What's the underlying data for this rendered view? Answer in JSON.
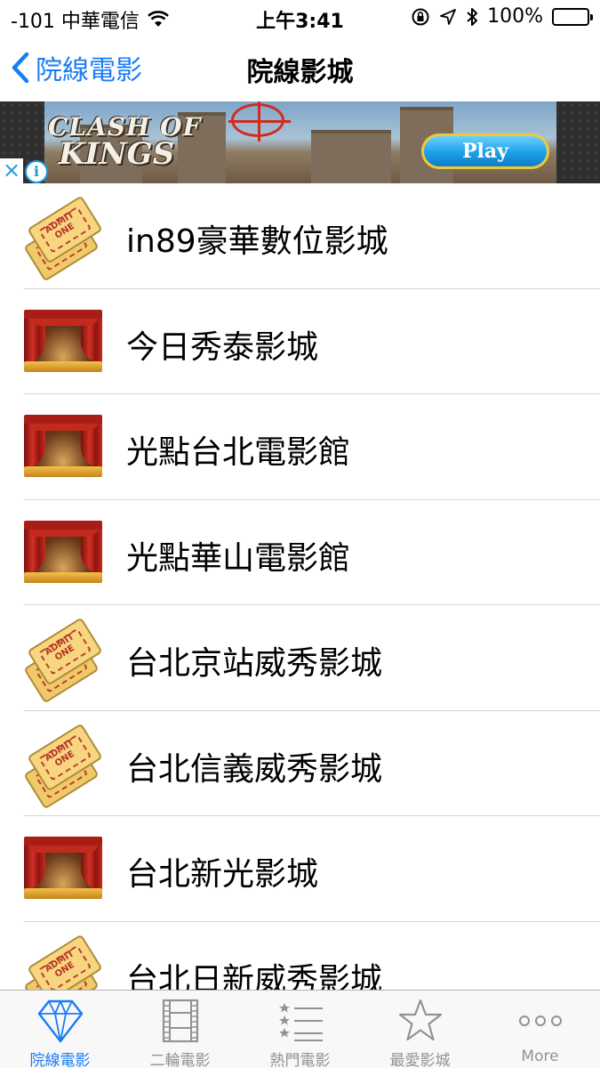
{
  "status_bar": {
    "carrier": "-101 中華電信",
    "time": "上午3:41",
    "battery": "100%",
    "battery_level": 1.0,
    "icons": [
      "wifi-icon",
      "orientation-lock-icon",
      "location-arrow-icon",
      "bluetooth-icon",
      "battery-icon"
    ]
  },
  "nav": {
    "back_label": "院線電影",
    "title": "院線影城"
  },
  "ad": {
    "logo_line1": "CLASH OF",
    "logo_line2": "KINGS",
    "play_label": "Play",
    "close_symbol": "×",
    "info_symbol": "i"
  },
  "cinemas": [
    {
      "name": "in89豪華數位影城",
      "icon": "ticket-icon"
    },
    {
      "name": "今日秀泰影城",
      "icon": "stage-icon"
    },
    {
      "name": "光點台北電影館",
      "icon": "stage-icon"
    },
    {
      "name": "光點華山電影館",
      "icon": "stage-icon"
    },
    {
      "name": "台北京站威秀影城",
      "icon": "ticket-icon"
    },
    {
      "name": "台北信義威秀影城",
      "icon": "ticket-icon"
    },
    {
      "name": "台北新光影城",
      "icon": "stage-icon"
    },
    {
      "name": "台北日新威秀影城",
      "icon": "ticket-icon"
    }
  ],
  "ticket_text": "ADMIT ONE",
  "tabs": [
    {
      "label": "院線電影",
      "icon": "diamond-icon",
      "active": true
    },
    {
      "label": "二輪電影",
      "icon": "film-strip-icon",
      "active": false
    },
    {
      "label": "熱門電影",
      "icon": "ranked-list-icon",
      "active": false
    },
    {
      "label": "最愛影城",
      "icon": "star-icon",
      "active": false
    },
    {
      "label": "More",
      "icon": "more-dots-icon",
      "active": false
    }
  ],
  "colors": {
    "accent": "#1a7cf5",
    "tab_inactive": "#929292",
    "separator": "#d6d6d6"
  }
}
